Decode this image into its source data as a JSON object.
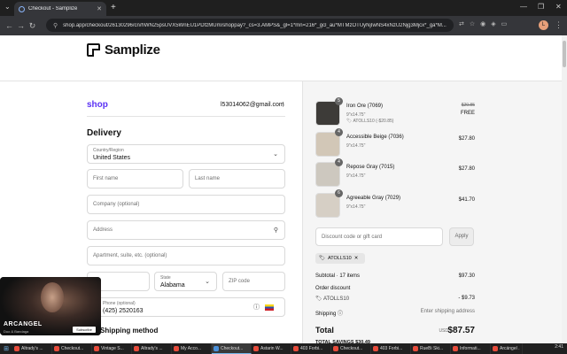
{
  "browser": {
    "tab_title": "Checkout - Samplize",
    "url": "shop.app/checkout/26130296/cn/hWN25psUVX5WnEU1PDfzMUm/shoppay?_cs=3.AMPS&_gl=1*mn=216*_gcl_au*MTMzOTUyNjIwNS4xNzU2Njg3Mjcx*_ga*M..."
  },
  "brand": {
    "name": "Samplize"
  },
  "checkout": {
    "shop_label": "shop",
    "email": "l53014062@gmail.com",
    "delivery_heading": "Delivery",
    "country_label": "Country/Region",
    "country_value": "United States",
    "first_name_ph": "First name",
    "last_name_ph": "Last name",
    "company_ph": "Company (optional)",
    "address_ph": "Address",
    "apartment_ph": "Apartment, suite, etc. (optional)",
    "state_label": "State",
    "state_value": "Alabama",
    "zip_ph": "ZIP code",
    "phone_label": "Phone (optional)",
    "phone_value": "(425) 2520163",
    "shipping_heading": "Shipping method"
  },
  "items": [
    {
      "name": "Iron Ore (7069)",
      "size": "9\"x14.75\"",
      "discount": "ATOLLS10 (-$20.85)",
      "old_price": "$20.85",
      "price": "FREE",
      "qty": "5",
      "color": "#3d3b38"
    },
    {
      "name": "Accessible Beige (7036)",
      "size": "9\"x14.75\"",
      "price": "$27.80",
      "qty": "4",
      "color": "#d2c7b7"
    },
    {
      "name": "Repose Gray (7015)",
      "size": "9\"x14.75\"",
      "price": "$27.80",
      "qty": "4",
      "color": "#cdc8bf"
    },
    {
      "name": "Agreeable Gray (7029)",
      "size": "9\"x14.75\"",
      "price": "$41.70",
      "qty": "6",
      "color": "#d6cfc5"
    }
  ],
  "summary": {
    "code_ph": "Discount code or gift card",
    "apply": "Apply",
    "chip": "ATOLLS10",
    "subtotal_label": "Subtotal · 17 items",
    "subtotal": "$97.30",
    "order_discount_label": "Order discount",
    "discount_code": "ATOLLS10",
    "discount_amount": "- $9.73",
    "shipping_label": "Shipping",
    "shipping_value": "Enter shipping address",
    "total_label": "Total",
    "currency": "USD",
    "total": "$87.57",
    "savings": "TOTAL SAVINGS $30.49"
  },
  "video": {
    "title": "ARCANGEL",
    "subtitle": "Duo & Bandaga",
    "subscribe": "Subscribe"
  },
  "taskbar": [
    {
      "label": "Altrady's ...",
      "color": "#e74c3c"
    },
    {
      "label": "Checkout...",
      "color": "#e74c3c"
    },
    {
      "label": "Vintage S...",
      "color": "#e74c3c"
    },
    {
      "label": "Altrady's ...",
      "color": "#e74c3c"
    },
    {
      "label": "My Acco...",
      "color": "#e74c3c"
    },
    {
      "label": "Checkout...",
      "color": "#4a90d9"
    },
    {
      "label": "Astarin W...",
      "color": "#e74c3c"
    },
    {
      "label": "403 Forbi...",
      "color": "#e74c3c"
    },
    {
      "label": "Checkout...",
      "color": "#e74c3c"
    },
    {
      "label": "403 Forbi...",
      "color": "#e74c3c"
    },
    {
      "label": "RueBi Ski...",
      "color": "#e74c3c"
    },
    {
      "label": "Informati...",
      "color": "#e74c3c"
    },
    {
      "label": "Arcángel ...",
      "color": "#e74c3c"
    }
  ],
  "clock": "2:41"
}
